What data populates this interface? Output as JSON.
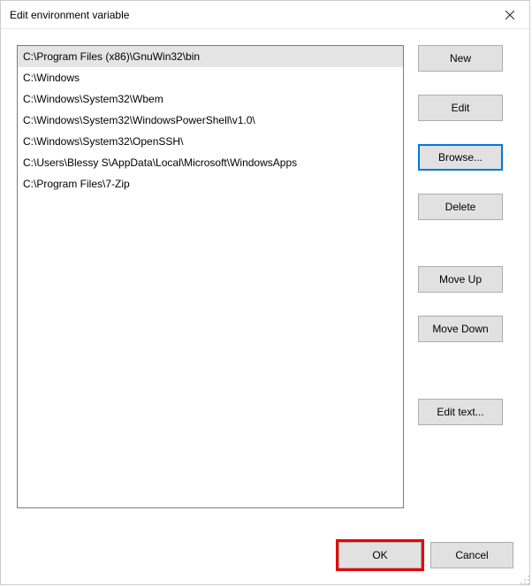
{
  "title": "Edit environment variable",
  "paths": [
    "C:\\Program Files (x86)\\GnuWin32\\bin",
    "C:\\Windows",
    "C:\\Windows\\System32\\Wbem",
    "C:\\Windows\\System32\\WindowsPowerShell\\v1.0\\",
    "C:\\Windows\\System32\\OpenSSH\\",
    "C:\\Users\\Blessy S\\AppData\\Local\\Microsoft\\WindowsApps",
    "C:\\Program Files\\7-Zip"
  ],
  "selectedIndex": 0,
  "buttons": {
    "new": "New",
    "edit": "Edit",
    "browse": "Browse...",
    "delete": "Delete",
    "moveUp": "Move Up",
    "moveDown": "Move Down",
    "editText": "Edit text...",
    "ok": "OK",
    "cancel": "Cancel"
  }
}
